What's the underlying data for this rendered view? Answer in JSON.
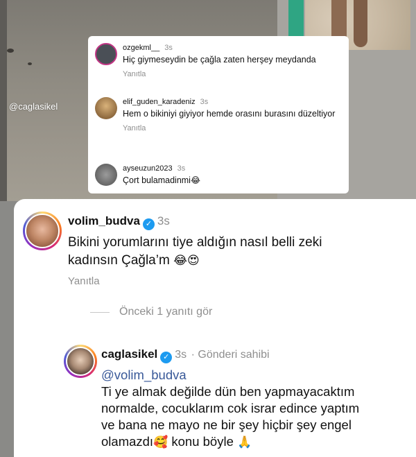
{
  "watermark": "@caglasikel",
  "mini_comments": [
    {
      "user": "ozgekml__",
      "time": "3s",
      "text": "Hiç giymeseydin be çağla zaten herşey meydanda",
      "reply": "Yanıtla"
    },
    {
      "user": "elif_guden_karadeniz",
      "time": "3s",
      "text": "Hem o bikiniyi giyiyor hemde orasını burasını düzeltiyor",
      "reply": "Yanıtla"
    },
    {
      "user": "ayseuzun2023",
      "time": "3s",
      "text": "Çort bulamadinmi",
      "emoji": "😂"
    }
  ],
  "main_comment": {
    "user": "volim_budva",
    "verified_mark": "✓",
    "time": "3s",
    "text": "Bikini yorumlarını tiye aldığın nasıl belli zeki kadınsın Çağla’m",
    "emojis": "😂😍",
    "reply": "Yanıtla",
    "view_replies": "Önceki 1 yanıtı gör"
  },
  "reply_comment": {
    "user": "caglasikel",
    "verified_mark": "✓",
    "time": "3s",
    "owner_label": "· Gönderi sahibi",
    "mention": "@volim_budva",
    "text_line1": "Ti ye almak değilde  dün ben yapmayacaktım",
    "text_line2": "normalde, cocuklarım cok israr edince yaptım",
    "text_line3": "ve bana ne mayo ne bir şey hiçbir şey engel",
    "text_line4a": "olamazdı",
    "emoji_a": "🥰",
    "text_line4b": " konu böyle ",
    "emoji_b": "🙏"
  }
}
